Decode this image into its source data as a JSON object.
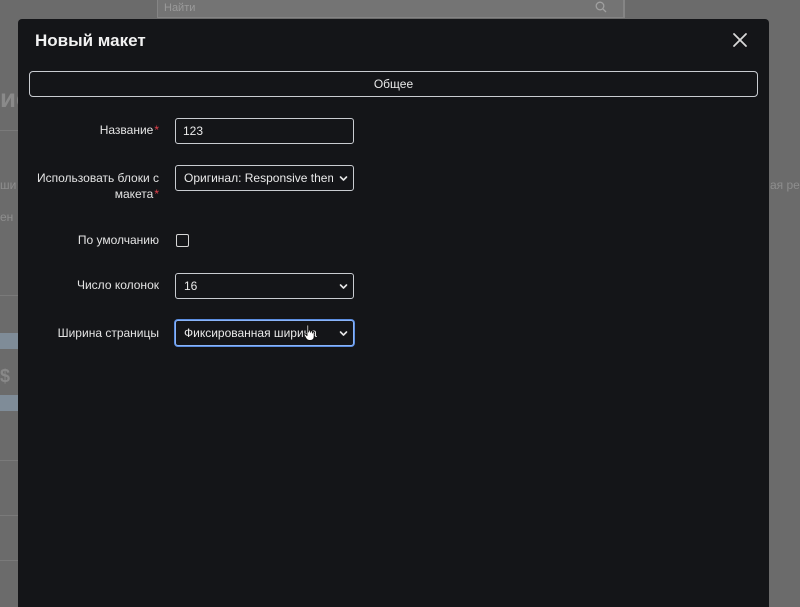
{
  "background": {
    "search_placeholder": "Найти",
    "fragment_heading": "ис",
    "fragment_left_1": "ши",
    "fragment_left_2": "ен",
    "fragment_right": "ая ре",
    "fragment_dollar": "$"
  },
  "modal": {
    "title": "Новый макет",
    "close_icon": "close-icon",
    "tab_general": "Общее",
    "fields": {
      "name": {
        "label": "Название",
        "required_mark": "*",
        "value": "123"
      },
      "use_blocks": {
        "label": "Использовать блоки с макета",
        "required_mark": "*",
        "selected": "Оригинал: Responsive theme"
      },
      "default": {
        "label": "По умолчанию",
        "checked": false
      },
      "columns": {
        "label": "Число колонок",
        "selected": "16"
      },
      "page_width": {
        "label": "Ширина страницы",
        "selected": "Фиксированная ширина"
      }
    }
  },
  "colors": {
    "modal_bg": "#141518",
    "border": "#c9ccd1",
    "required": "#e0404a",
    "focus": "#8ab4f8"
  }
}
